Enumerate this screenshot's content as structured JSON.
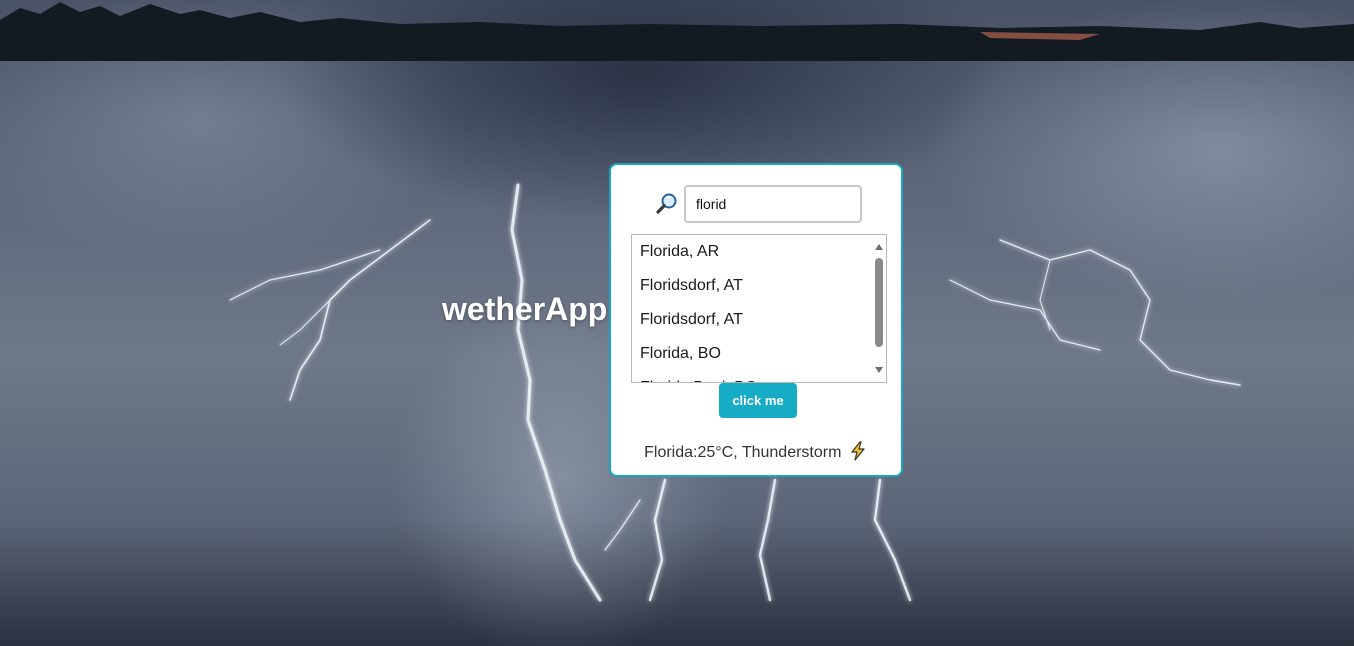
{
  "app": {
    "title": "wetherApp"
  },
  "search": {
    "value": "florid",
    "icon": "magnifying-glass-icon"
  },
  "suggestions": [
    "Florida, AR",
    "Floridsdorf, AT",
    "Floridsdorf, AT",
    "Florida, BO",
    "Florida Beni, BO"
  ],
  "action": {
    "button_label": "click me"
  },
  "result": {
    "text": "Florida:25°C, Thunderstorm",
    "icon": "lightning-bolt-icon"
  },
  "colors": {
    "accent": "#17acc6",
    "card_border": "#17a7bf",
    "bolt": "#f2c12e"
  }
}
